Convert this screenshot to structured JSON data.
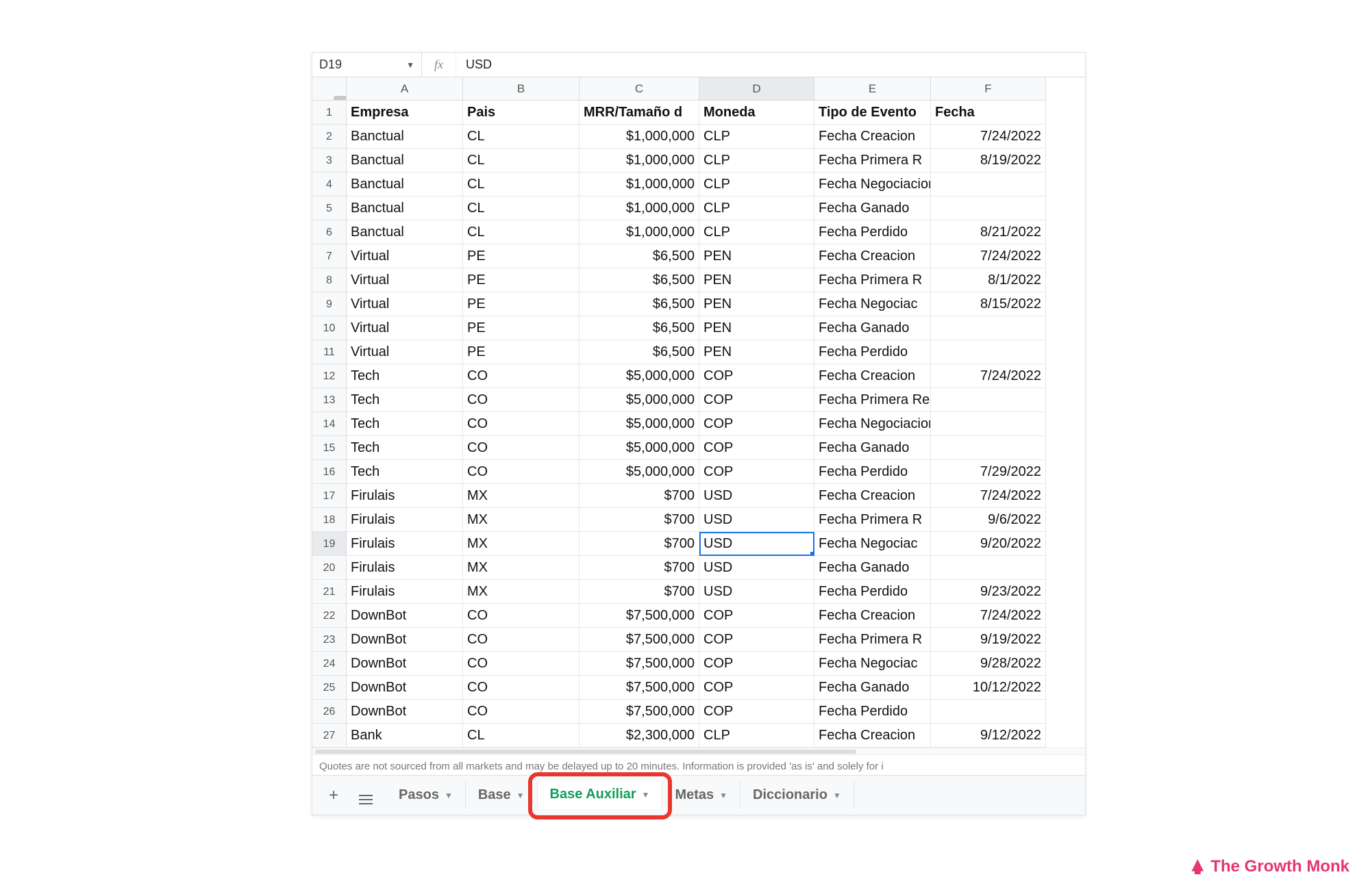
{
  "namebox": {
    "ref": "D19"
  },
  "fx": {
    "symbol": "fx",
    "value": "USD"
  },
  "columns": [
    "A",
    "B",
    "C",
    "D",
    "E",
    "F"
  ],
  "selected_col_index": 3,
  "selected_row_index": 19,
  "selected_cell": {
    "row": 19,
    "col": 3
  },
  "headers": [
    "Empresa",
    "Pais",
    "MRR/Tamaño d",
    "Moneda",
    "Tipo de Evento",
    "Fecha"
  ],
  "rows": [
    {
      "n": 1
    },
    {
      "n": 2,
      "a": "Banctual",
      "b": "CL",
      "c": "$1,000,000",
      "d": "CLP",
      "e": "Fecha Creacion",
      "f": "7/24/2022"
    },
    {
      "n": 3,
      "a": "Banctual",
      "b": "CL",
      "c": "$1,000,000",
      "d": "CLP",
      "e": "Fecha Primera R",
      "f": "8/19/2022"
    },
    {
      "n": 4,
      "a": "Banctual",
      "b": "CL",
      "c": "$1,000,000",
      "d": "CLP",
      "e": "Fecha Negociacion",
      "f": ""
    },
    {
      "n": 5,
      "a": "Banctual",
      "b": "CL",
      "c": "$1,000,000",
      "d": "CLP",
      "e": "Fecha Ganado",
      "f": ""
    },
    {
      "n": 6,
      "a": "Banctual",
      "b": "CL",
      "c": "$1,000,000",
      "d": "CLP",
      "e": "Fecha Perdido",
      "f": "8/21/2022"
    },
    {
      "n": 7,
      "a": "Virtual",
      "b": "PE",
      "c": "$6,500",
      "d": "PEN",
      "e": "Fecha Creacion",
      "f": "7/24/2022"
    },
    {
      "n": 8,
      "a": "Virtual",
      "b": "PE",
      "c": "$6,500",
      "d": "PEN",
      "e": "Fecha Primera R",
      "f": "8/1/2022"
    },
    {
      "n": 9,
      "a": "Virtual",
      "b": "PE",
      "c": "$6,500",
      "d": "PEN",
      "e": "Fecha Negociac",
      "f": "8/15/2022"
    },
    {
      "n": 10,
      "a": "Virtual",
      "b": "PE",
      "c": "$6,500",
      "d": "PEN",
      "e": "Fecha Ganado",
      "f": ""
    },
    {
      "n": 11,
      "a": "Virtual",
      "b": "PE",
      "c": "$6,500",
      "d": "PEN",
      "e": "Fecha Perdido",
      "f": ""
    },
    {
      "n": 12,
      "a": "Tech",
      "b": "CO",
      "c": "$5,000,000",
      "d": "COP",
      "e": "Fecha Creacion",
      "f": "7/24/2022"
    },
    {
      "n": 13,
      "a": "Tech",
      "b": "CO",
      "c": "$5,000,000",
      "d": "COP",
      "e": "Fecha Primera Reunion",
      "f": ""
    },
    {
      "n": 14,
      "a": "Tech",
      "b": "CO",
      "c": "$5,000,000",
      "d": "COP",
      "e": "Fecha Negociacion",
      "f": ""
    },
    {
      "n": 15,
      "a": "Tech",
      "b": "CO",
      "c": "$5,000,000",
      "d": "COP",
      "e": "Fecha Ganado",
      "f": ""
    },
    {
      "n": 16,
      "a": "Tech",
      "b": "CO",
      "c": "$5,000,000",
      "d": "COP",
      "e": "Fecha Perdido",
      "f": "7/29/2022"
    },
    {
      "n": 17,
      "a": "Firulais",
      "b": "MX",
      "c": "$700",
      "d": "USD",
      "e": "Fecha Creacion",
      "f": "7/24/2022"
    },
    {
      "n": 18,
      "a": "Firulais",
      "b": "MX",
      "c": "$700",
      "d": "USD",
      "e": "Fecha Primera R",
      "f": "9/6/2022"
    },
    {
      "n": 19,
      "a": "Firulais",
      "b": "MX",
      "c": "$700",
      "d": "USD",
      "e": "Fecha Negociac",
      "f": "9/20/2022"
    },
    {
      "n": 20,
      "a": "Firulais",
      "b": "MX",
      "c": "$700",
      "d": "USD",
      "e": "Fecha Ganado",
      "f": ""
    },
    {
      "n": 21,
      "a": "Firulais",
      "b": "MX",
      "c": "$700",
      "d": "USD",
      "e": "Fecha Perdido",
      "f": "9/23/2022"
    },
    {
      "n": 22,
      "a": "DownBot",
      "b": "CO",
      "c": "$7,500,000",
      "d": "COP",
      "e": "Fecha Creacion",
      "f": "7/24/2022"
    },
    {
      "n": 23,
      "a": "DownBot",
      "b": "CO",
      "c": "$7,500,000",
      "d": "COP",
      "e": "Fecha Primera R",
      "f": "9/19/2022"
    },
    {
      "n": 24,
      "a": "DownBot",
      "b": "CO",
      "c": "$7,500,000",
      "d": "COP",
      "e": "Fecha Negociac",
      "f": "9/28/2022"
    },
    {
      "n": 25,
      "a": "DownBot",
      "b": "CO",
      "c": "$7,500,000",
      "d": "COP",
      "e": "Fecha Ganado",
      "f": "10/12/2022"
    },
    {
      "n": 26,
      "a": "DownBot",
      "b": "CO",
      "c": "$7,500,000",
      "d": "COP",
      "e": "Fecha Perdido",
      "f": ""
    },
    {
      "n": 27,
      "a": "Bank",
      "b": "CL",
      "c": "$2,300,000",
      "d": "CLP",
      "e": "Fecha Creacion",
      "f": "9/12/2022"
    }
  ],
  "footer_note": "Quotes are not sourced from all markets and may be delayed up to 20 minutes. Information is provided 'as is' and solely for i",
  "tabs": {
    "add_label": "+",
    "items": [
      {
        "label": "Pasos",
        "active": false
      },
      {
        "label": "Base",
        "active": false
      },
      {
        "label": "Base Auxiliar",
        "active": true
      },
      {
        "label": "Metas",
        "active": false
      },
      {
        "label": "Diccionario",
        "active": false
      }
    ]
  },
  "watermark": "The Growth Monk"
}
